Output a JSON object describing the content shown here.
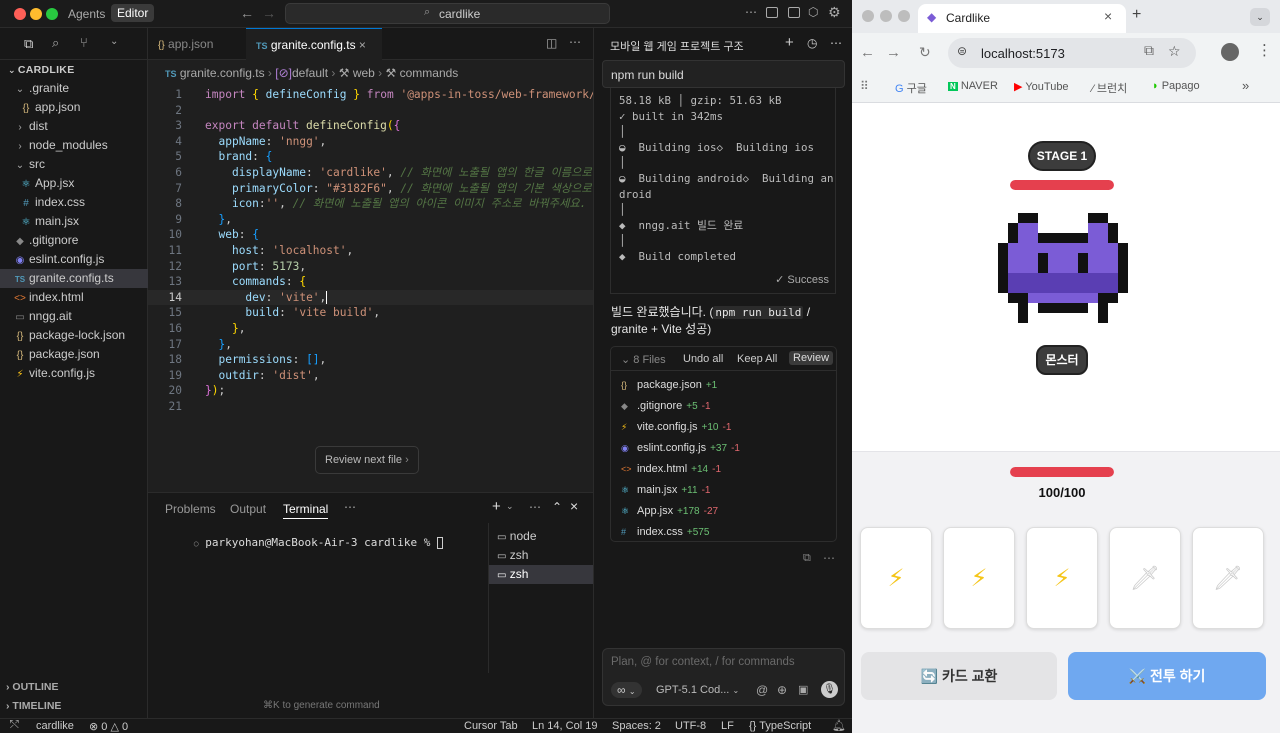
{
  "titlebar": {
    "agents": "Agents",
    "editor": "Editor",
    "search": "cardlike"
  },
  "sidebar": {
    "project": "CARDLIKE",
    "items": [
      {
        "label": ".granite",
        "icon": "chevron-down-icon",
        "depth": 0
      },
      {
        "label": "app.json",
        "icon": "json-icon",
        "depth": 1
      },
      {
        "label": "dist",
        "icon": "chevron-right-icon",
        "depth": 0
      },
      {
        "label": "node_modules",
        "icon": "chevron-right-icon",
        "depth": 0
      },
      {
        "label": "src",
        "icon": "chevron-down-icon",
        "depth": 0
      },
      {
        "label": "App.jsx",
        "icon": "react-icon",
        "depth": 1
      },
      {
        "label": "index.css",
        "icon": "css-icon",
        "depth": 1
      },
      {
        "label": "main.jsx",
        "icon": "react-icon",
        "depth": 1
      },
      {
        "label": ".gitignore",
        "icon": "git-icon",
        "depth": 0
      },
      {
        "label": "eslint.config.js",
        "icon": "eslint-icon",
        "depth": 0
      },
      {
        "label": "granite.config.ts",
        "icon": "ts-icon",
        "depth": 0
      },
      {
        "label": "index.html",
        "icon": "html-icon",
        "depth": 0
      },
      {
        "label": "nngg.ait",
        "icon": "file-icon",
        "depth": 0
      },
      {
        "label": "package-lock.json",
        "icon": "json-icon",
        "depth": 0
      },
      {
        "label": "package.json",
        "icon": "json-icon",
        "depth": 0
      },
      {
        "label": "vite.config.js",
        "icon": "vite-icon",
        "depth": 0
      }
    ],
    "outline": "OUTLINE",
    "timeline": "TIMELINE"
  },
  "editor": {
    "tabs": [
      "app.json",
      "granite.config.ts"
    ],
    "breadcrumb": [
      "granite.config.ts",
      "default",
      "web",
      "commands"
    ],
    "review_next": "Review next file",
    "cmdk_hint": "⌘K to generate command"
  },
  "panel": {
    "tabs": [
      "Problems",
      "Output",
      "Terminal"
    ],
    "prompt": "parkyohan@MacBook-Air-3 cardlike % ",
    "terminals": [
      "node",
      "zsh",
      "zsh"
    ]
  },
  "chat": {
    "title": "모바일 웹 게임 프로젝트 구조",
    "command": "npm run build",
    "output": [
      "58.18 kB │ gzip: 51.63 kB",
      "✓ built in 342ms",
      "│",
      "◒  Building ios◇  Building ios",
      "│",
      "◒  Building android◇  Building an",
      "droid",
      "│",
      "◆  nngg.ait 빌드 완료",
      "│",
      "◆  Build completed"
    ],
    "success": "✓ Success",
    "message_pre": "빌드 완료했습니다. (",
    "message_code": "npm run build",
    "message_post": " / granite + Vite 성공)",
    "files_count": "8 Files",
    "undo_all": "Undo all",
    "keep_all": "Keep All",
    "review": "Review",
    "files": [
      {
        "name": "package.json",
        "add": "+1",
        "del": "",
        "icon": "json-icon"
      },
      {
        "name": ".gitignore",
        "add": "+5",
        "del": "-1",
        "icon": "git-icon"
      },
      {
        "name": "vite.config.js",
        "add": "+10",
        "del": "-1",
        "icon": "vite-icon"
      },
      {
        "name": "eslint.config.js",
        "add": "+37",
        "del": "-1",
        "icon": "eslint-icon"
      },
      {
        "name": "index.html",
        "add": "+14",
        "del": "-1",
        "icon": "html-icon"
      },
      {
        "name": "main.jsx",
        "add": "+11",
        "del": "-1",
        "icon": "react-icon"
      },
      {
        "name": "App.jsx",
        "add": "+178",
        "del": "-27",
        "icon": "react-icon"
      },
      {
        "name": "index.css",
        "add": "+575",
        "del": "",
        "icon": "css-icon"
      }
    ],
    "input_placeholder": "Plan, @ for context, / for commands",
    "mode": "∞",
    "model": "GPT-5.1 Cod..."
  },
  "status": {
    "project": "cardlike",
    "errors": "0",
    "warnings": "0",
    "info": "0",
    "cursor_tab": "Cursor Tab",
    "position": "Ln 14, Col 19",
    "spaces": "Spaces: 2",
    "encoding": "UTF-8",
    "eol": "LF",
    "language": "TypeScript"
  },
  "browser": {
    "tab_title": "Cardlike",
    "url": "localhost:5173",
    "bookmarks": [
      "구글",
      "NAVER",
      "YouTube",
      "브런치",
      "Papago"
    ]
  },
  "game": {
    "stage": "STAGE 1",
    "enemy_name": "몬스터",
    "enemy_hp_fraction": 1.0,
    "player_hp": "100/100",
    "player_hp_fraction": 1.0,
    "cards": [
      "⚡",
      "⚡",
      "⚡",
      "🗡",
      "🗡"
    ],
    "swap_button": "🔄 카드 교환",
    "fight_button": "⚔️ 전투 하기",
    "colors": {
      "hp": "#e5404e",
      "fight": "#6fa8f0",
      "monster": "#7b5cd6"
    }
  }
}
